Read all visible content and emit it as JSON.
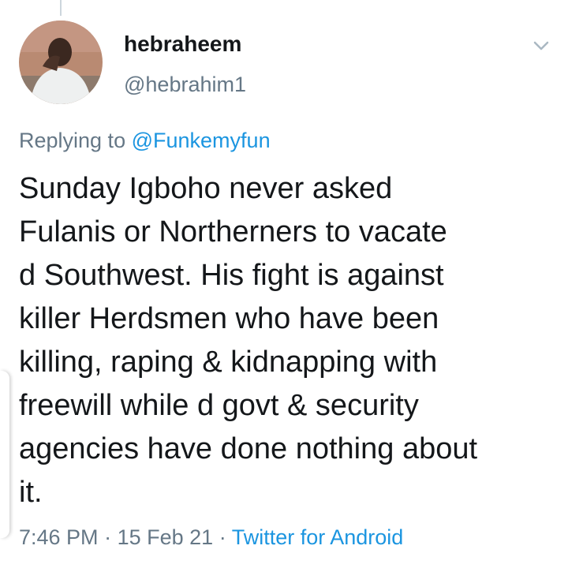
{
  "tweet": {
    "display_name": "hebraheem",
    "handle": "@hebrahim1",
    "reply_prefix": "Replying to",
    "reply_to": "@Funkemyfun",
    "text": "Sunday Igboho never asked\nFulanis or Northerners to vacate\nd Southwest. His fight is against\nkiller Herdsmen who have been\nkilling, raping & kidnapping with\nfreewill while d govt & security\nagencies have done nothing about\nit.",
    "time": "7:46 PM",
    "separator": "·",
    "date": "15 Feb 21",
    "source": "Twitter for Android"
  },
  "colors": {
    "text": "#14171a",
    "secondary": "#657786",
    "link": "#1b95e0"
  },
  "icons": {
    "menu": "chevron-down-icon"
  }
}
